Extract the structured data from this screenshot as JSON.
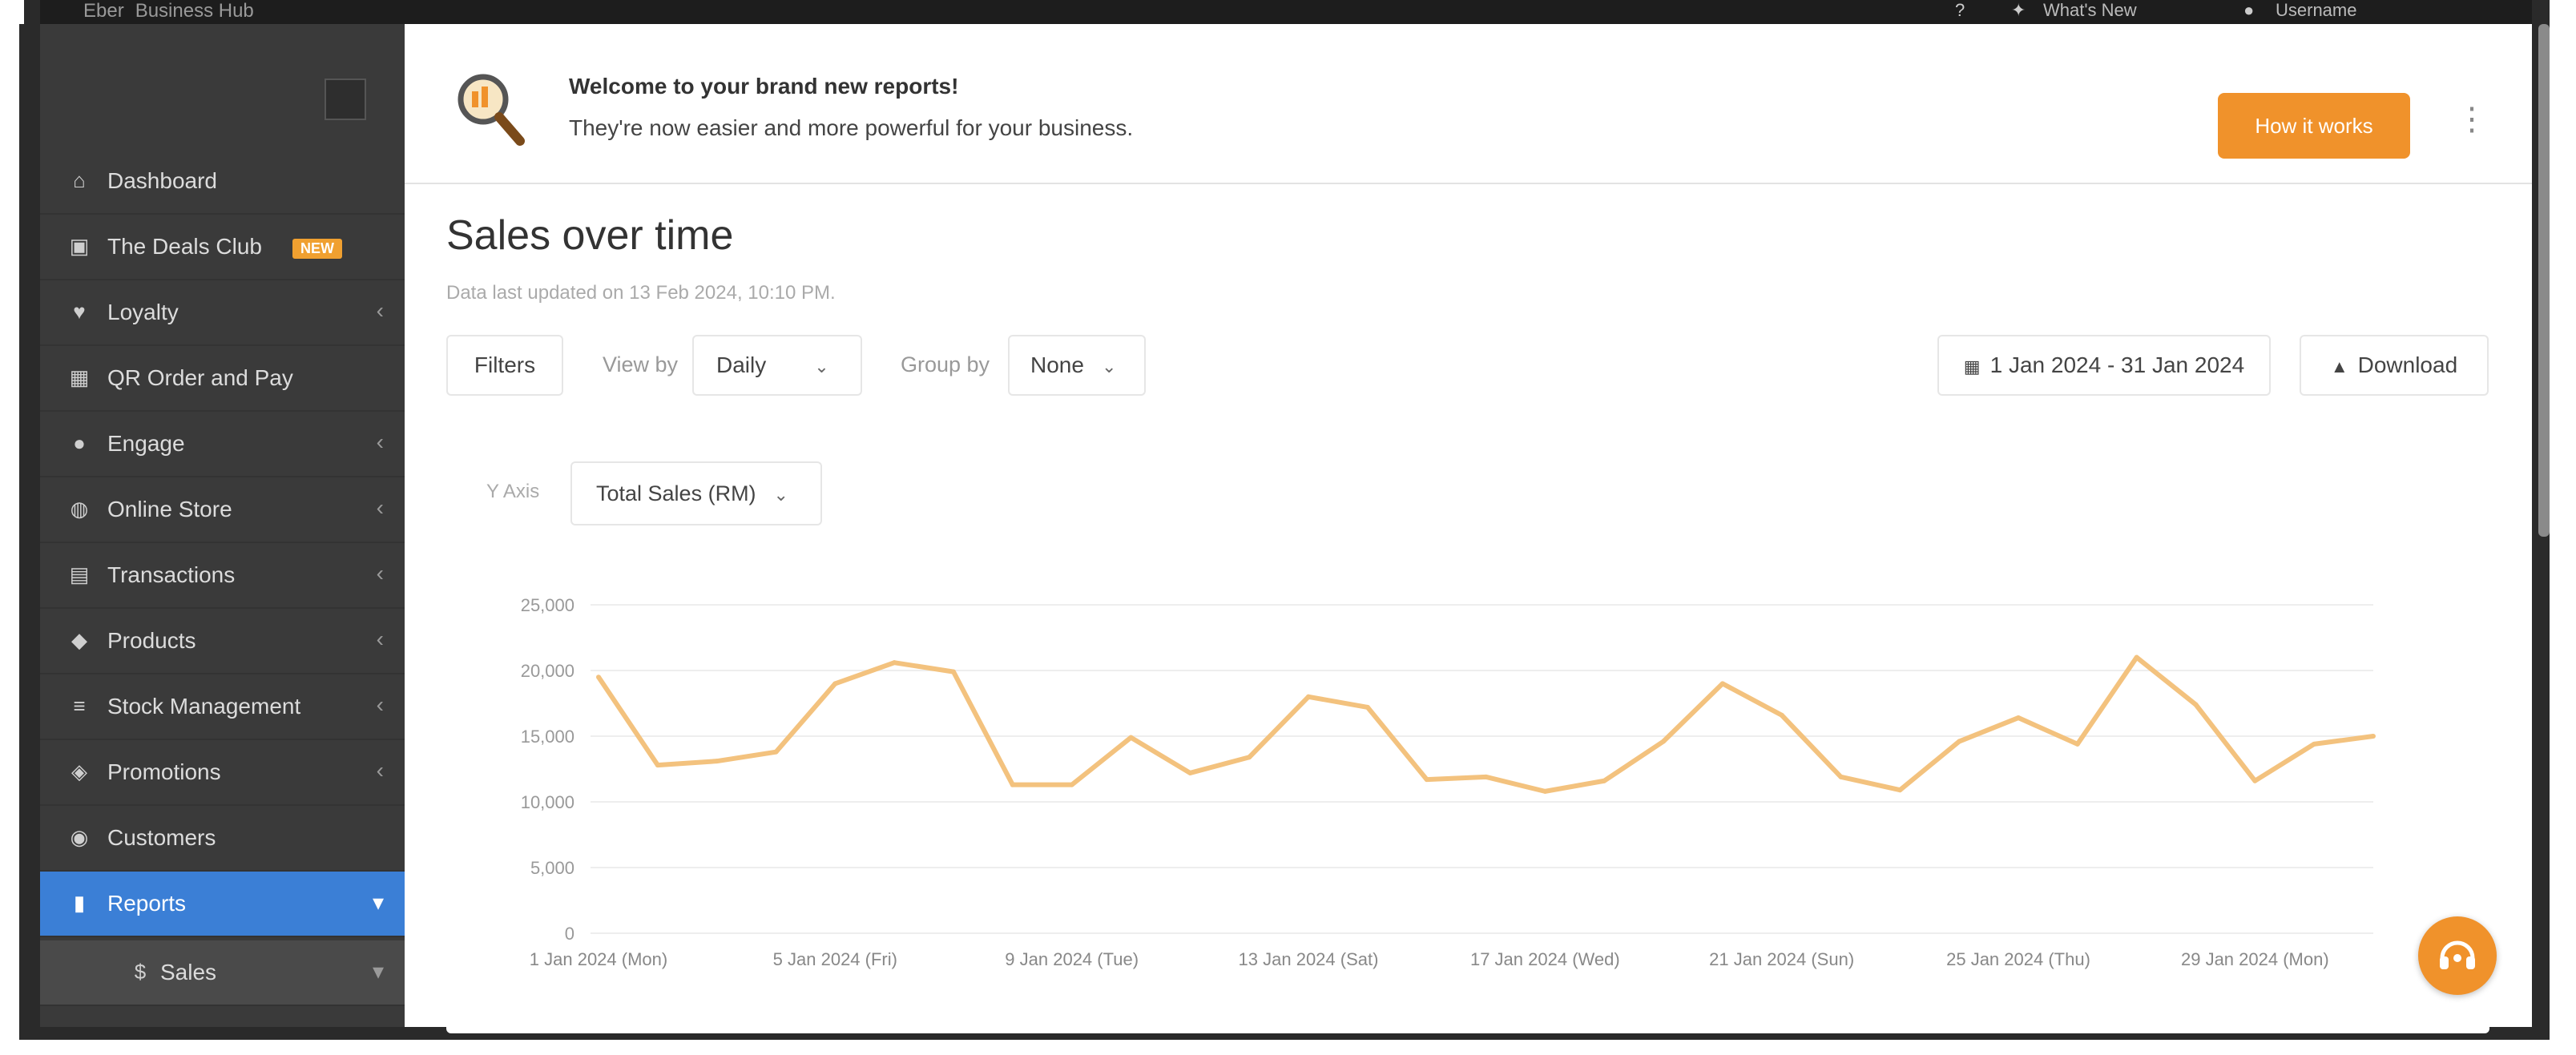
{
  "topbar": {
    "brand": "Eber",
    "brand_suffix": "Business Hub",
    "whats_new": "What's New",
    "user": "Username"
  },
  "sidebar": {
    "items": [
      {
        "label": "Dashboard",
        "icon": "home-icon",
        "chevron": false
      },
      {
        "label": "The Deals Club",
        "icon": "lock-icon",
        "chevron": false,
        "badge": "NEW"
      },
      {
        "label": "Loyalty",
        "icon": "heart-icon",
        "chevron": true
      },
      {
        "label": "QR Order and Pay",
        "icon": "qr-icon",
        "chevron": false
      },
      {
        "label": "Engage",
        "icon": "chat-icon",
        "chevron": true
      },
      {
        "label": "Online Store",
        "icon": "globe-icon",
        "chevron": true
      },
      {
        "label": "Transactions",
        "icon": "receipt-icon",
        "chevron": true
      },
      {
        "label": "Products",
        "icon": "tag-icon",
        "chevron": true
      },
      {
        "label": "Stock Management",
        "icon": "stock-icon",
        "chevron": true
      },
      {
        "label": "Promotions",
        "icon": "promo-icon",
        "chevron": true
      },
      {
        "label": "Customers",
        "icon": "users-icon",
        "chevron": false
      },
      {
        "label": "Reports",
        "icon": "chart-icon",
        "chevron": true,
        "active": true
      },
      {
        "label": "Sales",
        "icon": "dollar-icon",
        "chevron": true,
        "sub": true
      }
    ]
  },
  "banner": {
    "title": "Welcome to your brand new reports!",
    "subtitle": "They're now easier and more powerful for your business.",
    "button": "How it works"
  },
  "page": {
    "title": "Sales over time",
    "updated": "Data last updated on 13 Feb 2024, 10:10 PM."
  },
  "toolbar": {
    "filters": "Filters",
    "view_by_label": "View by",
    "view_by_value": "Daily",
    "group_by_label": "Group by",
    "group_by_value": "None",
    "date_range": "1 Jan 2024 - 31 Jan 2024",
    "download": "Download"
  },
  "chart_controls": {
    "y_axis_label": "Y Axis",
    "y_axis_value": "Total Sales (RM)"
  },
  "colors": {
    "accent": "#f0922b",
    "line": "#f3c27e",
    "active_nav": "#3b7fd6"
  },
  "chart_data": {
    "type": "line",
    "title": "",
    "xlabel": "",
    "ylabel": "",
    "ylim": [
      0,
      25000
    ],
    "yticks": [
      0,
      5000,
      10000,
      15000,
      20000,
      25000
    ],
    "ytick_labels": [
      "0",
      "5,000",
      "10,000",
      "15,000",
      "20,000",
      "25,000"
    ],
    "xtick_labels": [
      "1 Jan 2024 (Mon)",
      "5 Jan 2024 (Fri)",
      "9 Jan 2024 (Tue)",
      "13 Jan 2024 (Sat)",
      "17 Jan 2024 (Wed)",
      "21 Jan 2024 (Sun)",
      "25 Jan 2024 (Thu)",
      "29 Jan 2024 (Mon)"
    ],
    "grid": true,
    "x": [
      "1 Jan 2024",
      "2 Jan 2024",
      "3 Jan 2024",
      "4 Jan 2024",
      "5 Jan 2024",
      "6 Jan 2024",
      "7 Jan 2024",
      "8 Jan 2024",
      "9 Jan 2024",
      "10 Jan 2024",
      "11 Jan 2024",
      "12 Jan 2024",
      "13 Jan 2024",
      "14 Jan 2024",
      "15 Jan 2024",
      "16 Jan 2024",
      "17 Jan 2024",
      "18 Jan 2024",
      "19 Jan 2024",
      "20 Jan 2024",
      "21 Jan 2024",
      "22 Jan 2024",
      "23 Jan 2024",
      "24 Jan 2024",
      "25 Jan 2024",
      "26 Jan 2024",
      "27 Jan 2024",
      "28 Jan 2024",
      "29 Jan 2024",
      "30 Jan 2024",
      "31 Jan 2024"
    ],
    "series": [
      {
        "values": [
          19500,
          12800,
          13100,
          13800,
          19000,
          20600,
          19900,
          11300,
          11300,
          14900,
          12200,
          13400,
          18000,
          17200,
          11700,
          11900,
          10800,
          11600,
          14600,
          19000,
          16600,
          11900,
          10900,
          14600,
          16400,
          14400,
          21000,
          17400,
          11600,
          14400,
          15000
        ]
      }
    ]
  }
}
